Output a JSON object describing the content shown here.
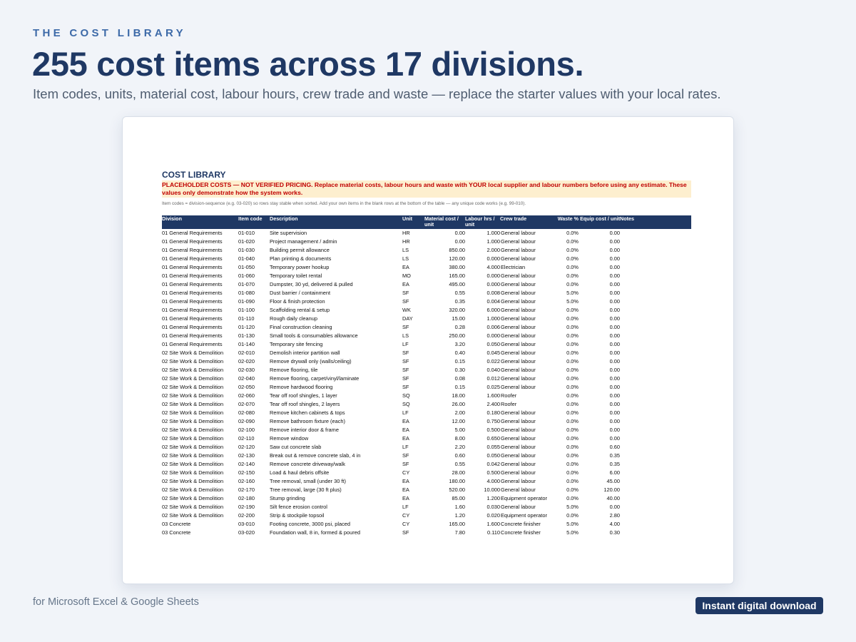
{
  "eyebrow": "THE COST LIBRARY",
  "headline": "255 cost items across 17 divisions.",
  "subhead": "Item codes, units, material cost, labour hours, crew trade and waste — replace the starter values with your local rates.",
  "sheet": {
    "title": "COST LIBRARY",
    "warning": "PLACEHOLDER COSTS — NOT VERIFIED PRICING.  Replace material costs, labour hours and waste with YOUR local supplier and labour numbers before using any estimate. These values only demonstrate how the system works.",
    "note": "Item codes = division-sequence (e.g. 03-020) so rows stay stable when sorted. Add your own items in the blank rows at the bottom of the table — any unique code works (e.g. 99-010).",
    "columns": [
      "Division",
      "Item code",
      "Description",
      "Unit",
      "Material cost / unit",
      "Labour hrs / unit",
      "Crew trade",
      "Waste %",
      "Equip cost / unit",
      "Notes"
    ],
    "rows": [
      [
        "01 General Requirements",
        "01-010",
        "Site supervision",
        "HR",
        "0.00",
        "1.000",
        "General labour",
        "0.0%",
        "0.00",
        ""
      ],
      [
        "01 General Requirements",
        "01-020",
        "Project management / admin",
        "HR",
        "0.00",
        "1.000",
        "General labour",
        "0.0%",
        "0.00",
        ""
      ],
      [
        "01 General Requirements",
        "01-030",
        "Building permit allowance",
        "LS",
        "850.00",
        "2.000",
        "General labour",
        "0.0%",
        "0.00",
        ""
      ],
      [
        "01 General Requirements",
        "01-040",
        "Plan printing & documents",
        "LS",
        "120.00",
        "0.000",
        "General labour",
        "0.0%",
        "0.00",
        ""
      ],
      [
        "01 General Requirements",
        "01-050",
        "Temporary power hookup",
        "EA",
        "380.00",
        "4.000",
        "Electrician",
        "0.0%",
        "0.00",
        ""
      ],
      [
        "01 General Requirements",
        "01-060",
        "Temporary toilet rental",
        "MO",
        "165.00",
        "0.000",
        "General labour",
        "0.0%",
        "0.00",
        ""
      ],
      [
        "01 General Requirements",
        "01-070",
        "Dumpster, 30 yd, delivered & pulled",
        "EA",
        "495.00",
        "0.000",
        "General labour",
        "0.0%",
        "0.00",
        ""
      ],
      [
        "01 General Requirements",
        "01-080",
        "Dust barrier / containment",
        "SF",
        "0.55",
        "0.008",
        "General labour",
        "5.0%",
        "0.00",
        ""
      ],
      [
        "01 General Requirements",
        "01-090",
        "Floor & finish protection",
        "SF",
        "0.35",
        "0.004",
        "General labour",
        "5.0%",
        "0.00",
        ""
      ],
      [
        "01 General Requirements",
        "01-100",
        "Scaffolding rental & setup",
        "WK",
        "320.00",
        "6.000",
        "General labour",
        "0.0%",
        "0.00",
        ""
      ],
      [
        "01 General Requirements",
        "01-110",
        "Rough daily cleanup",
        "DAY",
        "15.00",
        "1.000",
        "General labour",
        "0.0%",
        "0.00",
        ""
      ],
      [
        "01 General Requirements",
        "01-120",
        "Final construction cleaning",
        "SF",
        "0.28",
        "0.006",
        "General labour",
        "0.0%",
        "0.00",
        ""
      ],
      [
        "01 General Requirements",
        "01-130",
        "Small tools & consumables allowance",
        "LS",
        "250.00",
        "0.000",
        "General labour",
        "0.0%",
        "0.00",
        ""
      ],
      [
        "01 General Requirements",
        "01-140",
        "Temporary site fencing",
        "LF",
        "3.20",
        "0.050",
        "General labour",
        "0.0%",
        "0.00",
        ""
      ],
      [
        "02 Site Work & Demolition",
        "02-010",
        "Demolish interior partition wall",
        "SF",
        "0.40",
        "0.045",
        "General labour",
        "0.0%",
        "0.00",
        ""
      ],
      [
        "02 Site Work & Demolition",
        "02-020",
        "Remove drywall only (walls/ceiling)",
        "SF",
        "0.15",
        "0.022",
        "General labour",
        "0.0%",
        "0.00",
        ""
      ],
      [
        "02 Site Work & Demolition",
        "02-030",
        "Remove flooring, tile",
        "SF",
        "0.30",
        "0.040",
        "General labour",
        "0.0%",
        "0.00",
        ""
      ],
      [
        "02 Site Work & Demolition",
        "02-040",
        "Remove flooring, carpet/vinyl/laminate",
        "SF",
        "0.08",
        "0.012",
        "General labour",
        "0.0%",
        "0.00",
        ""
      ],
      [
        "02 Site Work & Demolition",
        "02-050",
        "Remove hardwood flooring",
        "SF",
        "0.15",
        "0.025",
        "General labour",
        "0.0%",
        "0.00",
        ""
      ],
      [
        "02 Site Work & Demolition",
        "02-060",
        "Tear off roof shingles, 1 layer",
        "SQ",
        "18.00",
        "1.600",
        "Roofer",
        "0.0%",
        "0.00",
        ""
      ],
      [
        "02 Site Work & Demolition",
        "02-070",
        "Tear off roof shingles, 2 layers",
        "SQ",
        "26.00",
        "2.400",
        "Roofer",
        "0.0%",
        "0.00",
        ""
      ],
      [
        "02 Site Work & Demolition",
        "02-080",
        "Remove kitchen cabinets & tops",
        "LF",
        "2.00",
        "0.180",
        "General labour",
        "0.0%",
        "0.00",
        ""
      ],
      [
        "02 Site Work & Demolition",
        "02-090",
        "Remove bathroom fixture (each)",
        "EA",
        "12.00",
        "0.750",
        "General labour",
        "0.0%",
        "0.00",
        ""
      ],
      [
        "02 Site Work & Demolition",
        "02-100",
        "Remove interior door & frame",
        "EA",
        "5.00",
        "0.500",
        "General labour",
        "0.0%",
        "0.00",
        ""
      ],
      [
        "02 Site Work & Demolition",
        "02-110",
        "Remove window",
        "EA",
        "8.00",
        "0.650",
        "General labour",
        "0.0%",
        "0.00",
        ""
      ],
      [
        "02 Site Work & Demolition",
        "02-120",
        "Saw cut concrete slab",
        "LF",
        "2.20",
        "0.055",
        "General labour",
        "0.0%",
        "0.60",
        ""
      ],
      [
        "02 Site Work & Demolition",
        "02-130",
        "Break out & remove concrete slab, 4 in",
        "SF",
        "0.60",
        "0.050",
        "General labour",
        "0.0%",
        "0.35",
        ""
      ],
      [
        "02 Site Work & Demolition",
        "02-140",
        "Remove concrete driveway/walk",
        "SF",
        "0.55",
        "0.042",
        "General labour",
        "0.0%",
        "0.35",
        ""
      ],
      [
        "02 Site Work & Demolition",
        "02-150",
        "Load & haul debris offsite",
        "CY",
        "28.00",
        "0.500",
        "General labour",
        "0.0%",
        "6.00",
        ""
      ],
      [
        "02 Site Work & Demolition",
        "02-160",
        "Tree removal, small (under 30 ft)",
        "EA",
        "180.00",
        "4.000",
        "General labour",
        "0.0%",
        "45.00",
        ""
      ],
      [
        "02 Site Work & Demolition",
        "02-170",
        "Tree removal, large (30 ft plus)",
        "EA",
        "520.00",
        "10.000",
        "General labour",
        "0.0%",
        "120.00",
        ""
      ],
      [
        "02 Site Work & Demolition",
        "02-180",
        "Stump grinding",
        "EA",
        "85.00",
        "1.200",
        "Equipment operator",
        "0.0%",
        "40.00",
        ""
      ],
      [
        "02 Site Work & Demolition",
        "02-190",
        "Silt fence erosion control",
        "LF",
        "1.60",
        "0.030",
        "General labour",
        "5.0%",
        "0.00",
        ""
      ],
      [
        "02 Site Work & Demolition",
        "02-200",
        "Strip & stockpile topsoil",
        "CY",
        "1.20",
        "0.020",
        "Equipment operator",
        "0.0%",
        "2.80",
        ""
      ],
      [
        "03 Concrete",
        "03-010",
        "Footing concrete, 3000 psi, placed",
        "CY",
        "165.00",
        "1.600",
        "Concrete finisher",
        "5.0%",
        "4.00",
        ""
      ],
      [
        "03 Concrete",
        "03-020",
        "Foundation wall, 8 in, formed & poured",
        "SF",
        "7.80",
        "0.110",
        "Concrete finisher",
        "5.0%",
        "0.30",
        ""
      ]
    ]
  },
  "footer_left": "for Microsoft Excel & Google Sheets",
  "badge": "Instant digital download",
  "colors": {
    "navy": "#1f3864",
    "eyebrow_blue": "#3d6aa8",
    "warning_bg": "#fdefcf",
    "warning_text": "#c00000",
    "page_bg": "#f1f4f9"
  }
}
